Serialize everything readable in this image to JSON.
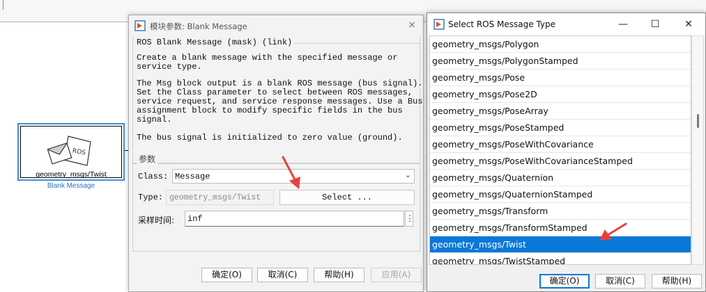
{
  "canvas": {
    "block": {
      "label": "geometry_msgs/Twist",
      "name": "Blank Message",
      "icon_text": "ROS"
    }
  },
  "param_dialog": {
    "title": "模块参数: Blank Message",
    "description_heading": "ROS Blank Message (mask) (link)",
    "description": [
      "Create a blank message with the specified message or\nservice type.",
      "The Msg block output is a blank ROS message (bus signal).\nSet the Class parameter to select between ROS messages,\nservice request, and service response messages. Use a Bus\nassignment block to modify specific fields in the bus\nsignal.",
      "The bus signal is initialized to zero value (ground)."
    ],
    "params_heading": "参数",
    "class_label": "Class:",
    "class_value": "Message",
    "type_label": "Type:",
    "type_value": "geometry_msgs/Twist",
    "select_button": "Select ...",
    "sample_time_label": "采样时间:",
    "sample_time_value": "inf",
    "more_button": "⋮",
    "buttons": {
      "ok": "确定(O)",
      "cancel": "取消(C)",
      "help": "帮助(H)",
      "apply": "应用(A)"
    },
    "close_icon": "×"
  },
  "ros_window": {
    "title": "Select ROS Message Type",
    "controls": {
      "minimize": "—",
      "maximize": "☐",
      "close": "✕"
    },
    "items": [
      "geometry_msgs/Polygon",
      "geometry_msgs/PolygonStamped",
      "geometry_msgs/Pose",
      "geometry_msgs/Pose2D",
      "geometry_msgs/PoseArray",
      "geometry_msgs/PoseStamped",
      "geometry_msgs/PoseWithCovariance",
      "geometry_msgs/PoseWithCovarianceStamped",
      "geometry_msgs/Quaternion",
      "geometry_msgs/QuaternionStamped",
      "geometry_msgs/Transform",
      "geometry_msgs/TransformStamped",
      "geometry_msgs/Twist",
      "geometry_msgs/TwistStamped"
    ],
    "selected_item": "geometry_msgs/Twist",
    "buttons": {
      "ok": "确定(O)",
      "cancel": "取消(C)",
      "help": "帮助(H)"
    }
  },
  "colors": {
    "selection": "#0a78d7",
    "annotation_arrow": "#e8403a",
    "block_border": "#3f8fd4"
  }
}
